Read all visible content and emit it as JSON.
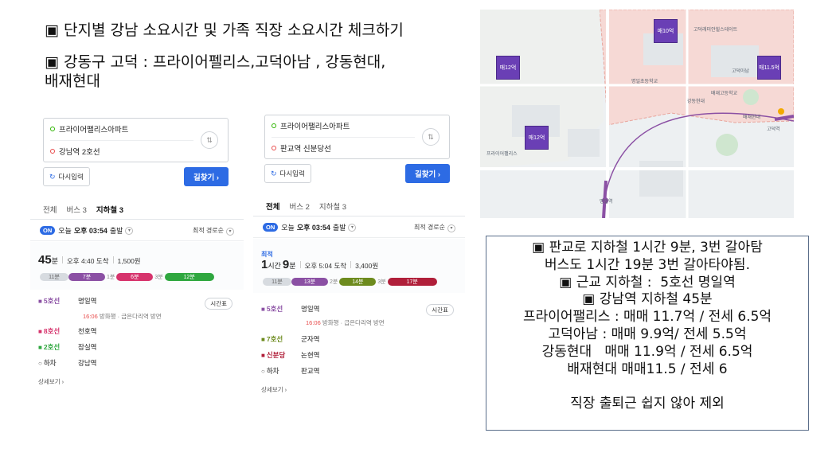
{
  "slide": {
    "line1": "▣ 단지별 강남 소요시간 및 가족 직장 소요시간 체크하기",
    "line2": "▣ 강동구 고덕 : 프라이어펠리스,고덕아남 , 강동현대,",
    "line3": "배재현대"
  },
  "routeA": {
    "from": "프라이어팰리스아파트",
    "to": "강남역 2호선",
    "reset_label": "다시입력",
    "search_label": "길찾기 ›",
    "tabs": [
      "전체",
      "버스 3",
      "지하철 3"
    ],
    "on_label": "ON",
    "day": "오늘",
    "time": "오후 03:54",
    "depart": "출발",
    "sort": "최적 경로순",
    "duration_num": "45",
    "duration_unit": "분",
    "arrive": "오후 4:40 도착",
    "fare": "1,500원",
    "segments": [
      {
        "label": "11분",
        "kind": "walk"
      },
      {
        "label": "7분",
        "color": "#8b50a4"
      },
      {
        "label": "1분",
        "kind": "gap"
      },
      {
        "label": "6분",
        "color": "#d6336c"
      },
      {
        "label": "3분",
        "kind": "gap"
      },
      {
        "label": "12분",
        "color": "#2fa73f"
      }
    ],
    "stops": [
      {
        "line": "5호선",
        "color": "#8b50a4",
        "station": "명일역"
      },
      {
        "line": "8호선",
        "color": "#d6336c",
        "station": "천호역"
      },
      {
        "line": "2호선",
        "color": "#2fa73f",
        "station": "잠실역"
      },
      {
        "line": "하차",
        "color": "#666666",
        "station": "강남역"
      }
    ],
    "sub_time": "16:06",
    "sub_text": "방화행 · 급은다리역 방면",
    "timetable": "시간표",
    "detail": "상세보기 ›"
  },
  "routeB": {
    "from": "프라이어팰리스아파트",
    "to": "판교역 신분당선",
    "reset_label": "다시입력",
    "search_label": "길찾기 ›",
    "tabs": [
      "전체",
      "버스 2",
      "지하철 3"
    ],
    "on_label": "ON",
    "day": "오늘",
    "time": "오후 03:54",
    "depart": "출발",
    "sort": "최적 경로순",
    "best": "최적",
    "duration_num1": "1",
    "duration_unit1": "시간",
    "duration_num2": "9",
    "duration_unit2": "분",
    "arrive": "오후 5:04 도착",
    "fare": "3,400원",
    "segments": [
      {
        "label": "11분",
        "kind": "walk"
      },
      {
        "label": "13분",
        "color": "#8b50a4"
      },
      {
        "label": "2분",
        "kind": "gap"
      },
      {
        "label": "14분",
        "color": "#6d8b1e"
      },
      {
        "label": "3분",
        "kind": "gap"
      },
      {
        "label": "17분",
        "color": "#b01f3a"
      }
    ],
    "stops": [
      {
        "line": "5호선",
        "color": "#8b50a4",
        "station": "명일역"
      },
      {
        "line": "7호선",
        "color": "#6d8b1e",
        "station": "군자역"
      },
      {
        "line": "신분당",
        "color": "#b01f3a",
        "station": "논현역"
      },
      {
        "line": "하차",
        "color": "#666666",
        "station": "판교역"
      }
    ],
    "sub_time": "16:06",
    "sub_text": "방화행 · 급은다리역 방면",
    "timetable": "시간표",
    "detail": "상세보기 ›"
  },
  "map": {
    "markers": [
      "매12억",
      "매10억",
      "매11.5억",
      "매12억"
    ],
    "labels": [
      "고덕래미안힐스테이트",
      "고덕아남",
      "배재현대",
      "강동현대",
      "프라이어팰리스",
      "명일역",
      "고덕역",
      "명일초등학교",
      "배재고등학교"
    ]
  },
  "note": {
    "lines": [
      "▣ 판교로 지하철 1시간 9분, 3번 갈아탐",
      "버스도 1시간 19분 3번 갈아타야됨.",
      "▣ 근교 지하철 :  5호선 명일역",
      "▣ 강남역 지하철 45분",
      "프라이어팰리스 : 매매 11.7억 / 전세 6.5억",
      "고덕아남 : 매매 9.9억/ 전세 5.5억",
      "강동현대   매매 11.9억 / 전세 6.5억",
      "배재현대 매매11.5 / 전세 6",
      "",
      "직장 출퇴근 쉽지 않아 제외"
    ]
  }
}
